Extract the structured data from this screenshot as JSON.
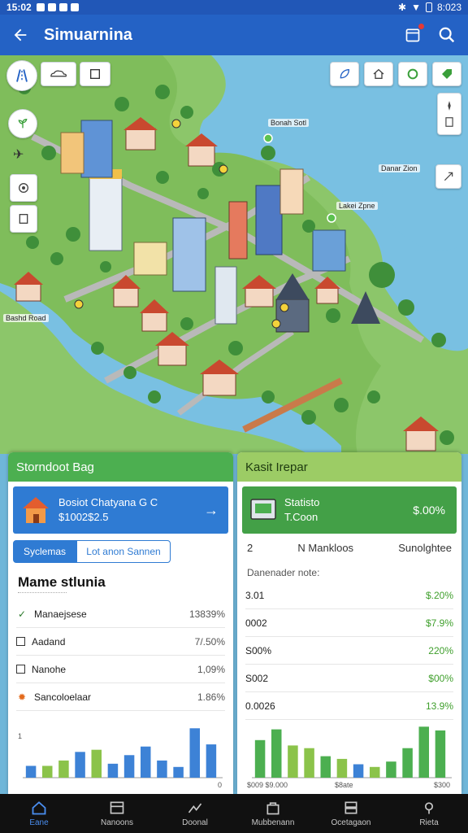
{
  "status_bar": {
    "time": "15:02",
    "right_time": "8:023"
  },
  "app_bar": {
    "title": "Simuarnina",
    "back_icon": "arrow-left-icon",
    "actions": [
      "calendar-icon",
      "search-icon"
    ]
  },
  "map": {
    "labels": [
      "Bonah Sotl",
      "Danar Zion",
      "Lakei Zpne",
      "Bashd Road"
    ],
    "top_buttons": [
      "leaf-icon",
      "home-icon",
      "recycle-icon",
      "tag-icon"
    ],
    "left_buttons": [
      "road-icon",
      "target-icon",
      "book-icon"
    ],
    "right_buttons": [
      "compass-icon",
      "exit-icon",
      "expand-icon"
    ]
  },
  "left_panel": {
    "header": "Storndoot Bag",
    "feature": {
      "line1": "Bosiot Chatyana G C",
      "line2": "$1002$2.5"
    },
    "segments": [
      "Syclemas",
      "Lot anon Sannen"
    ],
    "list_title": "Mame stlunia",
    "rows": [
      {
        "icon": "check-icon",
        "label": "Manaejsese",
        "value": "13839%"
      },
      {
        "icon": "box-icon",
        "label": "Aadand",
        "value": "7/.50%"
      },
      {
        "icon": "box-icon",
        "label": "Nanohe",
        "value": "1,09%"
      },
      {
        "icon": "gear-icon",
        "label": "Sancoloelaar",
        "value": "1.86%"
      }
    ],
    "chart_axis": {
      "ymax": "1",
      "xmax": "0"
    }
  },
  "right_panel": {
    "header": "Kasit Irepar",
    "feature": {
      "title": "Statisto",
      "subtitle": "T.Coon",
      "value": "$.00%"
    },
    "stats": [
      "2",
      "N Mankloos",
      "Sunolghtee"
    ],
    "subtitle": "Danenader note:",
    "rows": [
      {
        "label": "3.01",
        "value": "$.20%"
      },
      {
        "label": "0002",
        "value": "$7.9%"
      },
      {
        "label": "S00%",
        "value": "220%"
      },
      {
        "label": "S002",
        "value": "$00%"
      },
      {
        "label": "0.0026",
        "value": "13.9%"
      }
    ],
    "chart_axis": {
      "x_start": "$009 $9.000",
      "x_mid": "$8ate",
      "x_end": "$300"
    }
  },
  "bottom_nav": [
    {
      "icon": "home-icon",
      "label": "Eane"
    },
    {
      "icon": "window-icon",
      "label": "Nanoons"
    },
    {
      "icon": "chart-icon",
      "label": "Doonal"
    },
    {
      "icon": "bag-icon",
      "label": "Mubbenann"
    },
    {
      "icon": "layers-icon",
      "label": "Ocetagaon"
    },
    {
      "icon": "pin-icon",
      "label": "Rieta"
    }
  ],
  "chart_data": [
    {
      "type": "bar",
      "series": [
        {
          "name": "",
          "values": [
            0.22,
            0.22,
            0.32,
            0.48,
            0.52,
            0.26,
            0.42,
            0.58,
            0.32,
            0.2,
            0.92,
            0.62
          ],
          "colors": [
            "#3d82d6",
            "#8bc34a",
            "#8bc34a",
            "#3d82d6",
            "#8bc34a",
            "#3d82d6",
            "#3d82d6",
            "#3d82d6",
            "#3d82d6",
            "#3d82d6",
            "#3d82d6",
            "#3d82d6"
          ]
        }
      ]
    },
    {
      "type": "bar",
      "series": [
        {
          "name": "",
          "values": [
            0.7,
            0.9,
            0.6,
            0.55,
            0.4,
            0.35,
            0.25,
            0.2,
            0.3,
            0.55,
            0.95,
            0.88
          ],
          "colors": [
            "#4caf50",
            "#4caf50",
            "#8bc34a",
            "#8bc34a",
            "#4caf50",
            "#8bc34a",
            "#3d82d6",
            "#8bc34a",
            "#4caf50",
            "#4caf50",
            "#4caf50",
            "#4caf50"
          ]
        }
      ]
    }
  ]
}
